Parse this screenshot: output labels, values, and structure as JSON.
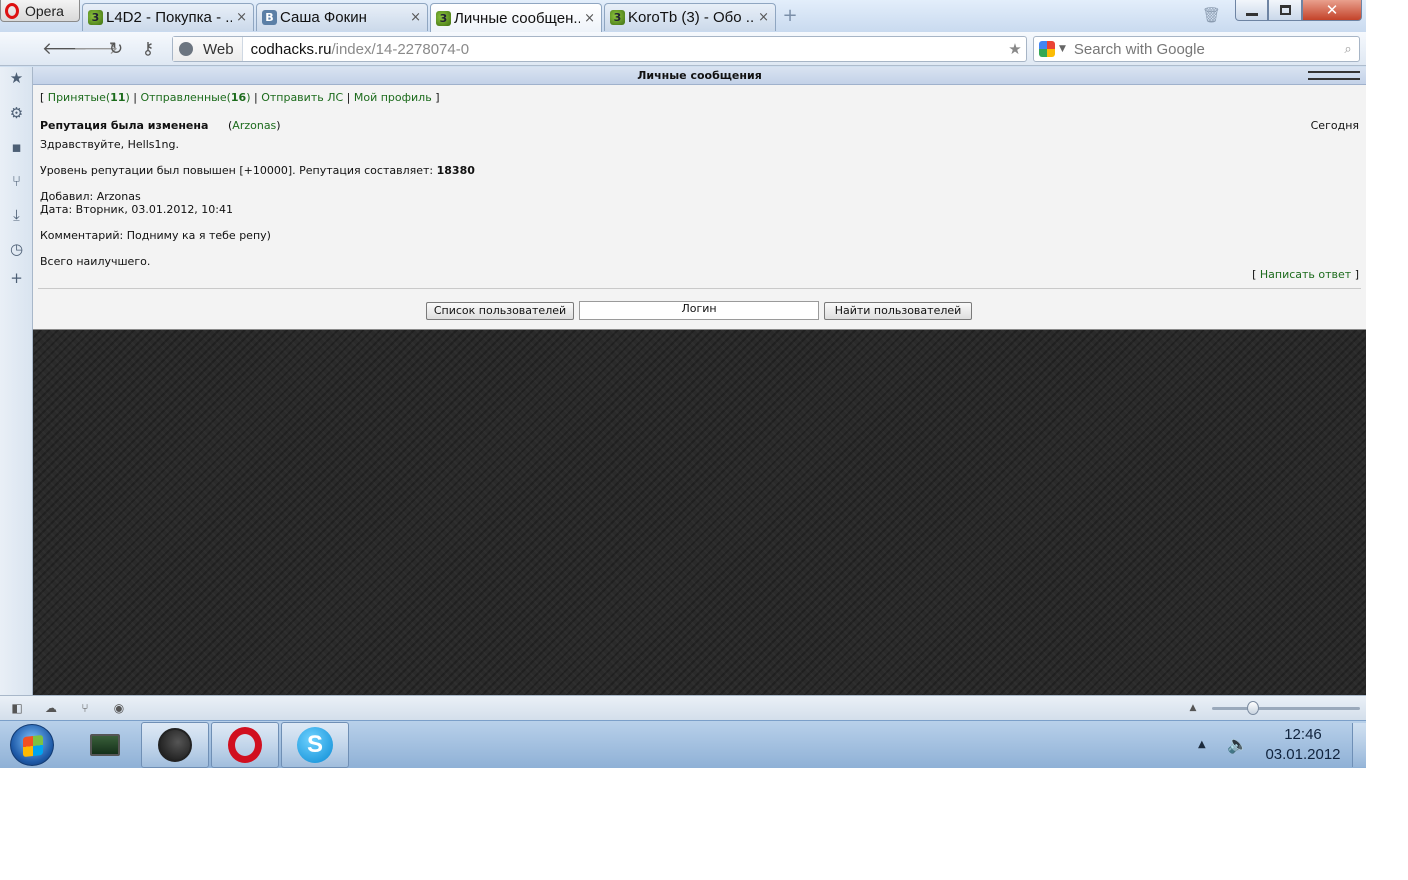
{
  "browser": {
    "menu_label": "Opera",
    "tabs": [
      {
        "title": "L4D2 - Покупка - ...",
        "favicon": "codhacks-icon"
      },
      {
        "title": "Саша Фокин",
        "favicon": "vk-icon"
      },
      {
        "title": "Личные сообщен...",
        "favicon": "codhacks-icon",
        "active": true
      },
      {
        "title": "KoroTb (3) - Обо ...",
        "favicon": "codhacks-icon"
      }
    ],
    "close_glyph": "×",
    "new_tab_glyph": "+",
    "address": {
      "scheme_label": "Web",
      "domain": "codhacks.ru",
      "path": "/index/14-2278074-0"
    },
    "search": {
      "placeholder": "Search with Google",
      "engine_icon": "google-icon"
    }
  },
  "page": {
    "header_title": "Личные сообщения",
    "nav": {
      "open": "[ ",
      "inbox_label": "Принятые",
      "inbox_count": "11",
      "sep1": " | ",
      "sent_label": "Отправленные",
      "sent_count": "16",
      "sep2": " | ",
      "send_label": "Отправить ЛС",
      "sep3": " | ",
      "profile_label": "Мой профиль",
      "close": " ]"
    },
    "message": {
      "title": "Репутация была изменена",
      "author": "Arzonas",
      "date_header": "Сегодня",
      "greeting": "Здравствуйте, Hells1ng.",
      "reputation_text": "Уровень репутации был повышен [+10000]. Репутация составляет: ",
      "reputation_value": "18380",
      "added_by": "Добавил: Arzonas",
      "date": "Дата: Вторник, 03.01.2012, 10:41",
      "comment": "Комментарий: Подниму ка я тебе репу)",
      "closing": "Всего наилучшего.",
      "reply_label": "Написать ответ"
    },
    "users_list_button": "Список пользователей",
    "login_value": "Логин",
    "find_users_button": "Найти пользователей"
  },
  "taskbar": {
    "time": "12:46",
    "date": "03.01.2012"
  },
  "colors": {
    "link": "#1c6b1c",
    "page_background": "#2a2a2a",
    "panel_background": "#f3f3f3",
    "close_button": "#c3432a"
  }
}
